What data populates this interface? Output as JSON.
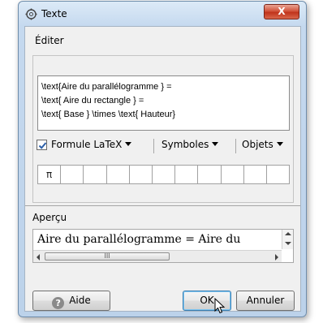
{
  "window": {
    "title": "Texte",
    "close_label": "X"
  },
  "editor": {
    "group_label": "Éditer",
    "lines": [
      "\\text{Aire du parallélogramme } =",
      "\\text{ Aire du rectangle } =",
      "\\text{ Base } \\times \\text{ Hauteur}"
    ],
    "latex_checkbox": {
      "label": "Formule LaTeX",
      "checked": true
    },
    "symbols_dropdown": "Symboles",
    "objects_dropdown": "Objets",
    "symbol_cells": [
      "π",
      "",
      "",
      "",
      "",
      "",
      "",
      "",
      "",
      "",
      ""
    ]
  },
  "preview": {
    "label": "Aperçu",
    "text": "Aire du parallélogramme  =  Aire du",
    "scroll_thumb_label": "III"
  },
  "buttons": {
    "help": "Aide",
    "ok": "OK",
    "cancel": "Annuler"
  },
  "icons": {
    "title_icon": "gear-icon",
    "help_icon": "help-icon",
    "cursor": "mouse-pointer-icon"
  }
}
